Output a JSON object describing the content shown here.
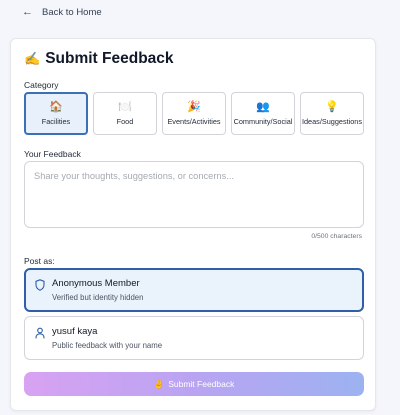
{
  "nav": {
    "back_label": "Back to Home",
    "back_icon": "←"
  },
  "form": {
    "title_emoji": "✍️",
    "title": "Submit Feedback",
    "category_label": "Category",
    "categories": [
      {
        "icon": "🏠",
        "label": "Facilities",
        "selected": true
      },
      {
        "icon": "🍽️",
        "label": "Food",
        "selected": false
      },
      {
        "icon": "🎉",
        "label": "Events/Activities",
        "selected": false
      },
      {
        "icon": "👥",
        "label": "Community/Social",
        "selected": false
      },
      {
        "icon": "💡",
        "label": "Ideas/Suggestions",
        "selected": false
      }
    ],
    "feedback_label": "Your Feedback",
    "feedback_placeholder": "Share your thoughts, suggestions, or concerns...",
    "feedback_value": "",
    "char_counter": "0/500 characters",
    "post_as_label": "Post as:",
    "post_options": [
      {
        "title": "Anonymous Member",
        "subtitle": "Verified but identity hidden",
        "icon": "shield-icon",
        "selected": true
      },
      {
        "title": "yusuf kaya",
        "subtitle": "Public feedback with your name",
        "icon": "user-icon",
        "selected": false
      }
    ],
    "submit_icon": "✌️",
    "submit_label": "Submit Feedback"
  },
  "colors": {
    "accent": "#2e5fa8",
    "selected_bg": "#eaf2fb",
    "submit_gradient_start": "#d9a2f2",
    "submit_gradient_end": "#9cb2f0"
  }
}
